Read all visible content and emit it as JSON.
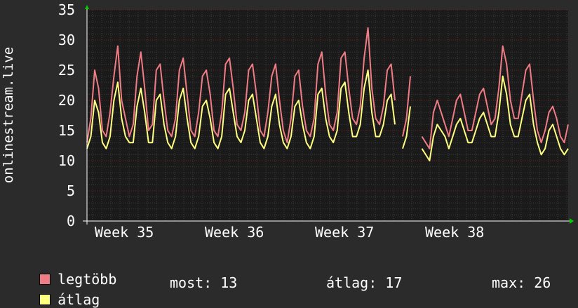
{
  "chart_data": {
    "type": "line",
    "ylabel": "onlinestream.live",
    "ylim": [
      0,
      35
    ],
    "yticks": [
      0,
      5,
      10,
      15,
      20,
      25,
      30,
      35
    ],
    "xticks": [
      "Week 35",
      "Week 36",
      "Week 37",
      "Week 38"
    ],
    "grid": true,
    "legend_position": "bottom-left",
    "gaps": [
      [
        0.645,
        0.648
      ],
      [
        0.677,
        0.688
      ]
    ],
    "series": [
      {
        "name": "legtöbb",
        "color": "#f07c85",
        "values": [
          13,
          17,
          25,
          22,
          15,
          14,
          18,
          24,
          29,
          20,
          17,
          14,
          16,
          24,
          28,
          22,
          15,
          16,
          25,
          26,
          20,
          15,
          14,
          17,
          25,
          27,
          21,
          15,
          14,
          18,
          24,
          25,
          21,
          15,
          14,
          18,
          26,
          27,
          22,
          16,
          15,
          18,
          25,
          26,
          21,
          15,
          14,
          18,
          24,
          26,
          20,
          15,
          13,
          17,
          24,
          25,
          19,
          15,
          14,
          17,
          26,
          28,
          21,
          16,
          15,
          18,
          27,
          28,
          22,
          17,
          16,
          19,
          27,
          32,
          22,
          17,
          16,
          19,
          25,
          26,
          20,
          15,
          14,
          17,
          24,
          25,
          20,
          14,
          13,
          12,
          18,
          20,
          18,
          16,
          14,
          17,
          20,
          21,
          18,
          15,
          15,
          18,
          21,
          22,
          19,
          16,
          17,
          22,
          29,
          26,
          20,
          17,
          17,
          21,
          25,
          26,
          20,
          15,
          13,
          15,
          18,
          19,
          17,
          14,
          13,
          16
        ]
      },
      {
        "name": "átlag",
        "color": "#ffff80",
        "values": [
          12,
          14,
          20,
          18,
          13,
          12,
          14,
          20,
          23,
          17,
          14,
          13,
          13,
          19,
          22,
          18,
          13,
          13,
          20,
          21,
          16,
          13,
          12,
          14,
          20,
          22,
          17,
          13,
          12,
          14,
          19,
          20,
          17,
          13,
          12,
          14,
          21,
          22,
          18,
          14,
          13,
          15,
          20,
          21,
          17,
          13,
          12,
          14,
          19,
          21,
          16,
          13,
          12,
          14,
          19,
          20,
          16,
          13,
          12,
          14,
          21,
          22,
          17,
          14,
          13,
          15,
          22,
          23,
          18,
          14,
          14,
          16,
          22,
          25,
          18,
          14,
          14,
          16,
          20,
          21,
          16,
          13,
          12,
          14,
          19,
          20,
          16,
          12,
          11,
          10,
          14,
          16,
          15,
          14,
          12,
          14,
          16,
          17,
          15,
          13,
          13,
          15,
          17,
          18,
          16,
          14,
          14,
          18,
          24,
          21,
          16,
          14,
          14,
          17,
          20,
          21,
          16,
          13,
          11,
          12,
          15,
          16,
          14,
          12,
          11,
          12
        ]
      }
    ]
  },
  "legend": {
    "max_label": "legtöbb",
    "avg_label": "átlag",
    "now": "most: 13",
    "avg": "átlag: 17",
    "max": "max: 26"
  },
  "colors": {
    "background": "#2b2b2b",
    "plot_bg": "#1a1a1a",
    "grid_minor": "#3a3a3a",
    "grid_major": "#7a2020",
    "axis": "#ffffff",
    "arrow": "#00cc00"
  }
}
